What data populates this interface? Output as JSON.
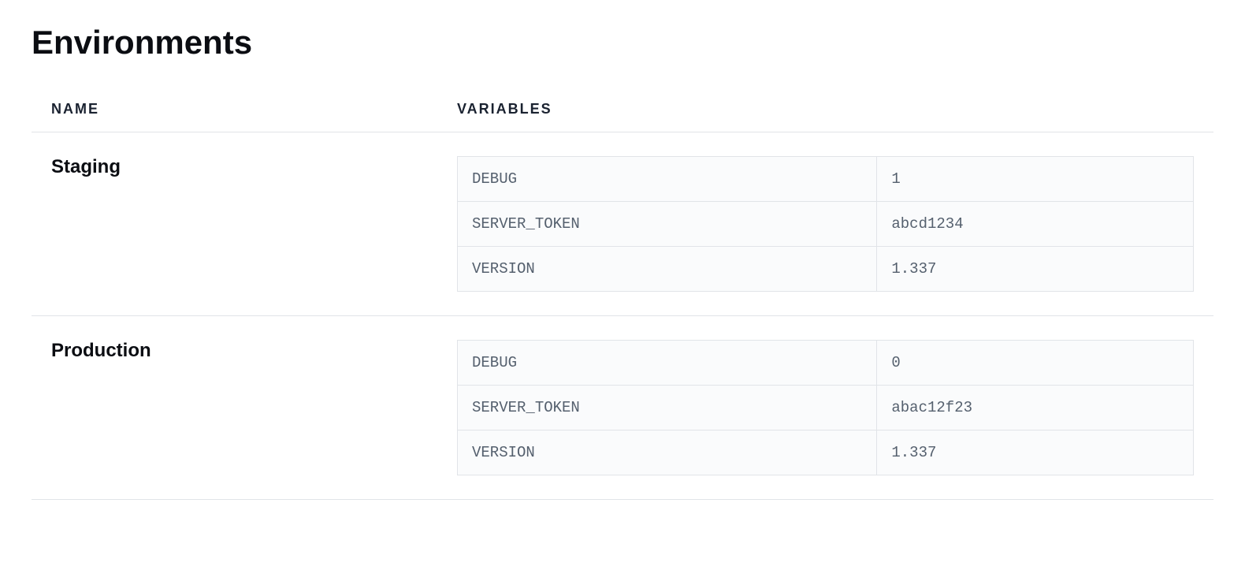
{
  "page": {
    "title": "Environments"
  },
  "columns": {
    "name": "NAME",
    "variables": "VARIABLES"
  },
  "environments": [
    {
      "name": "Staging",
      "variables": [
        {
          "key": "DEBUG",
          "value": "1"
        },
        {
          "key": "SERVER_TOKEN",
          "value": "abcd1234"
        },
        {
          "key": "VERSION",
          "value": "1.337"
        }
      ]
    },
    {
      "name": "Production",
      "variables": [
        {
          "key": "DEBUG",
          "value": "0"
        },
        {
          "key": "SERVER_TOKEN",
          "value": "abac12f23"
        },
        {
          "key": "VERSION",
          "value": "1.337"
        }
      ]
    }
  ]
}
